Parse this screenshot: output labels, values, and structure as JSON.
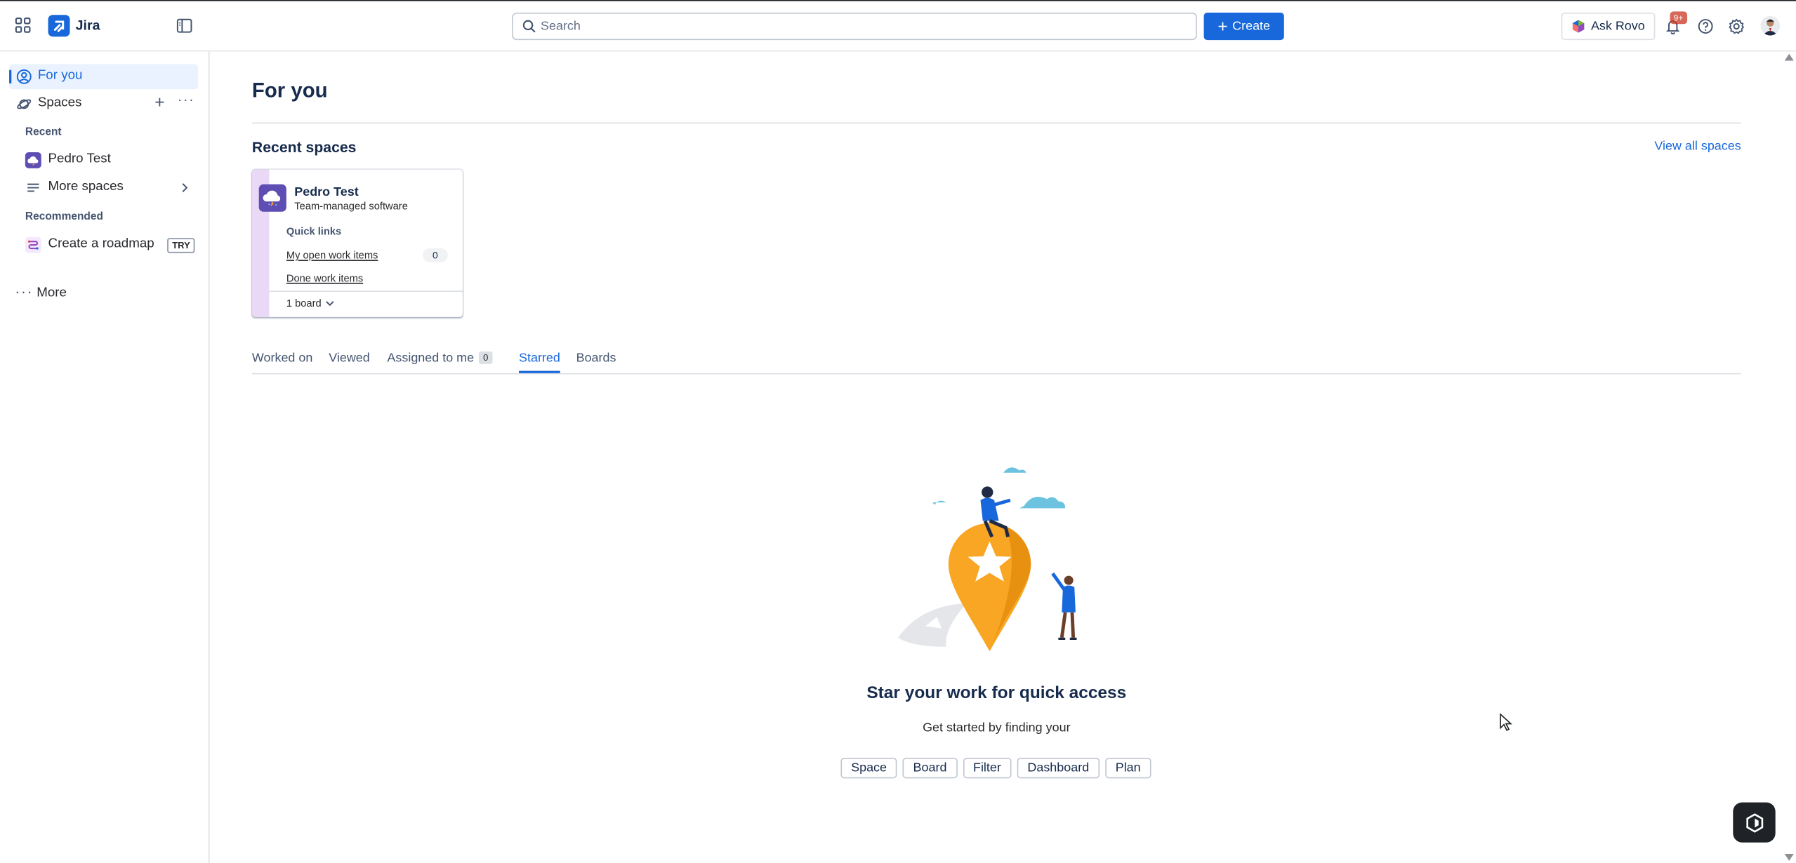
{
  "app": {
    "name": "Jira"
  },
  "topbar": {
    "search_placeholder": "Search",
    "create_label": "Create",
    "rovo_label": "Ask Rovo",
    "notifications_badge": "9+"
  },
  "sidebar": {
    "for_you": "For you",
    "spaces": "Spaces",
    "recent_heading": "Recent",
    "recent_space": "Pedro Test",
    "more_spaces": "More spaces",
    "recommended_heading": "Recommended",
    "roadmap": "Create a roadmap",
    "roadmap_badge": "TRY",
    "more": "More"
  },
  "main": {
    "title": "For you",
    "recent_spaces_heading": "Recent spaces",
    "view_all": "View all spaces",
    "card": {
      "name": "Pedro Test",
      "type": "Team-managed software",
      "quick_links_heading": "Quick links",
      "link1": "My open work items",
      "link1_count": "0",
      "link2": "Done work items",
      "boards": "1 board"
    },
    "tabs": [
      {
        "label": "Worked on"
      },
      {
        "label": "Viewed"
      },
      {
        "label": "Assigned to me",
        "count": "0"
      },
      {
        "label": "Starred",
        "active": true
      },
      {
        "label": "Boards"
      }
    ],
    "empty": {
      "title": "Star your work for quick access",
      "subtitle": "Get started by finding your",
      "chips": [
        "Space",
        "Board",
        "Filter",
        "Dashboard",
        "Plan"
      ]
    }
  },
  "colors": {
    "brand": "#1868db",
    "active_bg": "#e9f2fe",
    "text": "#172b4d",
    "pin": "#f8a623"
  }
}
